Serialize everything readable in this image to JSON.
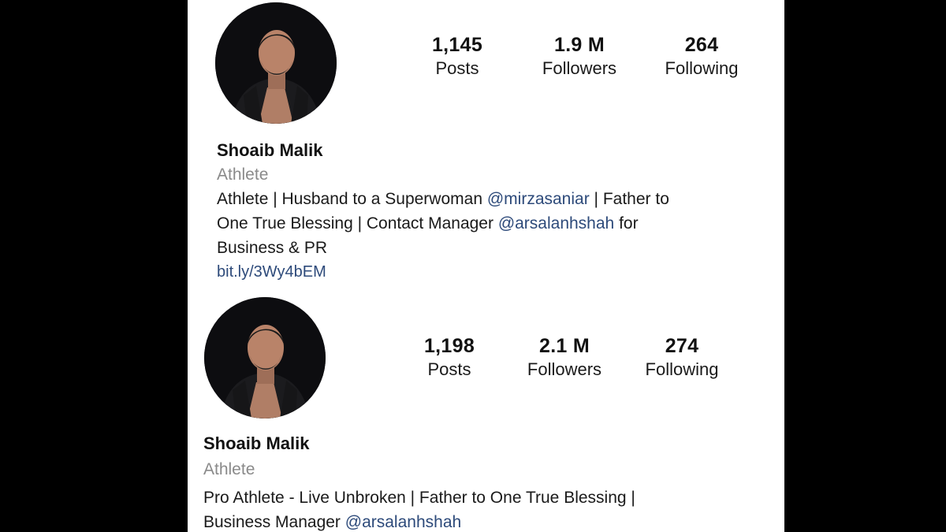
{
  "profiles": [
    {
      "stats": {
        "posts": {
          "value": "1,145",
          "label": "Posts"
        },
        "followers": {
          "value": "1.9 M",
          "label": "Followers"
        },
        "following": {
          "value": "264",
          "label": "Following"
        }
      },
      "name": "Shoaib Malik",
      "category": "Athlete",
      "bio": {
        "line1_a": "Athlete | Husband to a Superwoman ",
        "line1_mention": "@mirzasaniar",
        "line1_b": " | Father to",
        "line2_a": "One True Blessing | Contact Manager ",
        "line2_mention": "@arsalanhshah",
        "line2_b": " for",
        "line3": "Business & PR"
      },
      "link": "bit.ly/3Wy4bEM"
    },
    {
      "stats": {
        "posts": {
          "value": "1,198",
          "label": "Posts"
        },
        "followers": {
          "value": "2.1 M",
          "label": "Followers"
        },
        "following": {
          "value": "274",
          "label": "Following"
        }
      },
      "name": "Shoaib Malik",
      "category": "Athlete",
      "bio": {
        "line1": "Pro Athlete - Live Unbroken | Father to One True Blessing |",
        "line2_a": "Business Manager ",
        "line2_mention": "@arsalanhshah"
      }
    }
  ]
}
